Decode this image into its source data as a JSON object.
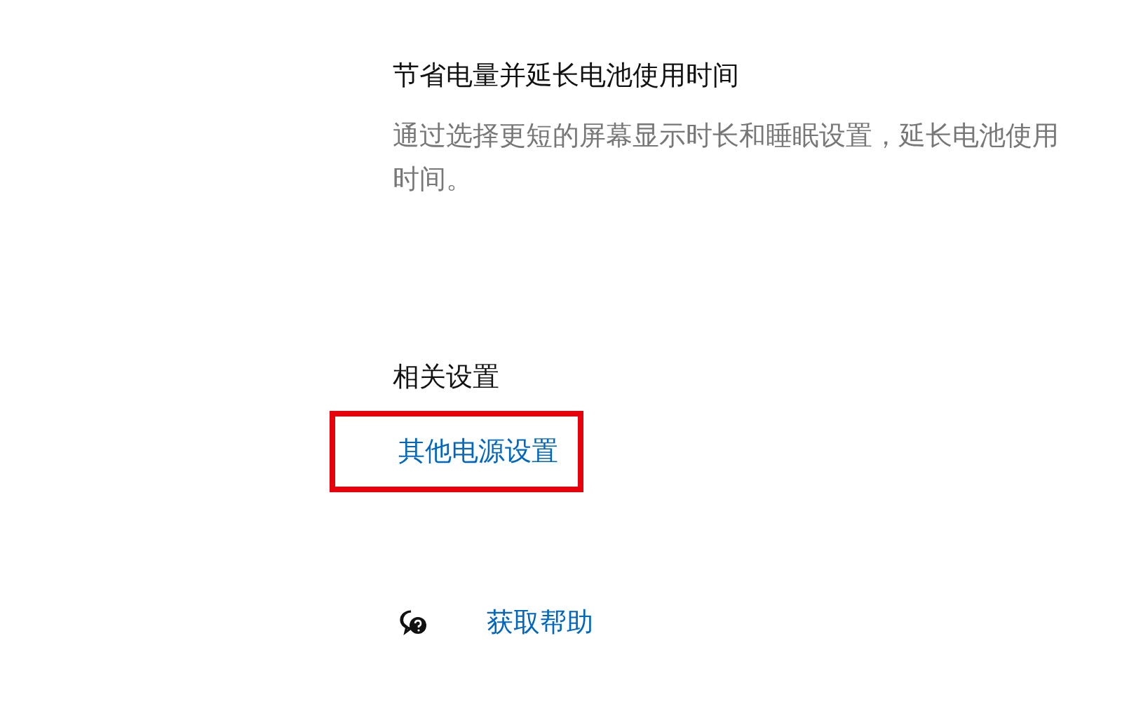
{
  "tip": {
    "title": "节省电量并延长电池使用时间",
    "description": "通过选择更短的屏幕显示时长和睡眠设置，延长电池使用时间。"
  },
  "related": {
    "heading": "相关设置",
    "links": [
      {
        "label": "其他电源设置",
        "highlighted": true
      }
    ]
  },
  "help": {
    "label": "获取帮助"
  }
}
